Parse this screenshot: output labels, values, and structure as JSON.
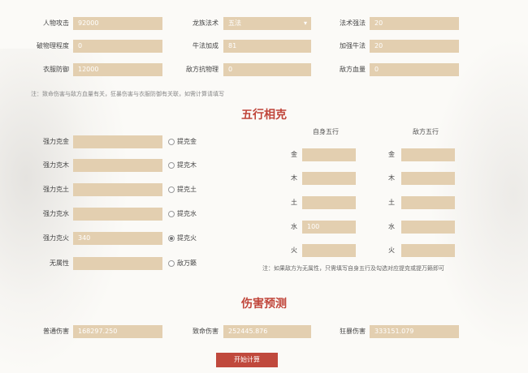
{
  "top": {
    "rows": [
      [
        {
          "label": "人物攻击",
          "value": "92000",
          "type": "input"
        },
        {
          "label": "龙族法术",
          "value": "五法",
          "type": "select"
        },
        {
          "label": "法术强法",
          "value": "20",
          "type": "input"
        }
      ],
      [
        {
          "label": "破物理程度",
          "value": "0",
          "type": "input"
        },
        {
          "label": "牛法加成",
          "value": "81",
          "type": "input"
        },
        {
          "label": "加强牛法",
          "value": "20",
          "type": "input"
        }
      ],
      [
        {
          "label": "衣服防御",
          "value": "12000",
          "type": "input"
        },
        {
          "label": "敌方抗物理",
          "value": "0",
          "type": "input"
        },
        {
          "label": "敌方血量",
          "value": "0",
          "type": "input"
        }
      ]
    ],
    "note": "注：致命伤害与敌方血量有关，狂暴伤害与衣服防御有关联，如需计算请填写"
  },
  "wuxing": {
    "title": "五行相克",
    "left_rows": [
      {
        "label": "强力克金",
        "value": "",
        "radio_label": "提克金",
        "selected": false
      },
      {
        "label": "强力克木",
        "value": "",
        "radio_label": "提克木",
        "selected": false
      },
      {
        "label": "强力克土",
        "value": "",
        "radio_label": "提克土",
        "selected": false
      },
      {
        "label": "强力克水",
        "value": "",
        "radio_label": "提克水",
        "selected": false
      },
      {
        "label": "强力克火",
        "value": "340",
        "radio_label": "提克火",
        "selected": true
      },
      {
        "label": "无属性",
        "value": "",
        "radio_label": "敌万籁",
        "selected": false
      }
    ],
    "self_head": "自身五行",
    "enemy_head": "敌方五行",
    "self_rows": [
      {
        "label": "金",
        "value": ""
      },
      {
        "label": "木",
        "value": ""
      },
      {
        "label": "土",
        "value": ""
      },
      {
        "label": "水",
        "value": "100"
      },
      {
        "label": "火",
        "value": ""
      }
    ],
    "enemy_rows": [
      {
        "label": "金",
        "value": ""
      },
      {
        "label": "木",
        "value": ""
      },
      {
        "label": "土",
        "value": ""
      },
      {
        "label": "水",
        "value": ""
      },
      {
        "label": "火",
        "value": ""
      }
    ],
    "note": "注：如果敌方为无属性，只需填写自身五行及勾选对应提克或提万籁即可"
  },
  "predict": {
    "title": "伤害预测",
    "items": [
      {
        "label": "普通伤害",
        "value": "168297.250"
      },
      {
        "label": "致命伤害",
        "value": "252445.876"
      },
      {
        "label": "狂暴伤害",
        "value": "333151.079"
      }
    ],
    "button": "开始计算"
  }
}
